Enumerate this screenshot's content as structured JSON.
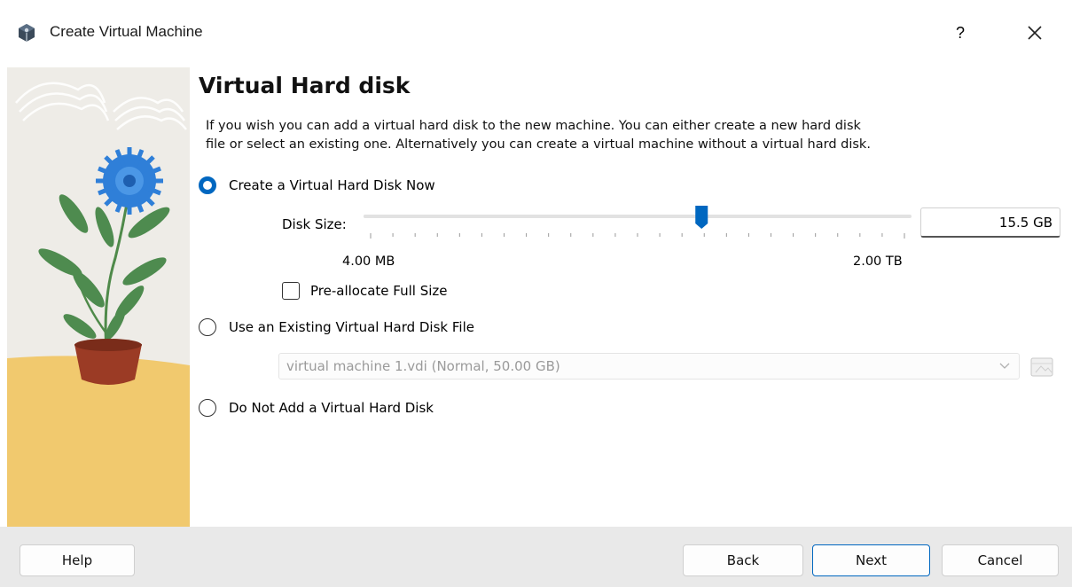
{
  "window": {
    "title": "Create Virtual Machine",
    "help_label": "?"
  },
  "page": {
    "heading": "Virtual Hard disk",
    "description_line1": "If you wish you can add a virtual hard disk to the new machine. You can either create a new hard disk",
    "description_line2": "file or select an existing one. Alternatively you can create a virtual machine without a virtual hard disk."
  },
  "options": {
    "create_now": {
      "label": "Create a Virtual Hard Disk Now",
      "checked": true
    },
    "use_existing": {
      "label": "Use an Existing Virtual Hard Disk File",
      "checked": false
    },
    "do_not_add": {
      "label": "Do Not Add a Virtual Hard Disk",
      "checked": false
    }
  },
  "disk_size": {
    "label": "Disk Size:",
    "value": "15.5 GB",
    "min_label": "4.00 MB",
    "max_label": "2.00 TB",
    "slider_fraction": 0.62
  },
  "preallocate": {
    "label": "Pre-allocate Full Size",
    "checked": false
  },
  "existing_file": {
    "selected": "virtual machine 1.vdi (Normal, 50.00 GB)",
    "enabled": false
  },
  "buttons": {
    "help": "Help",
    "back": "Back",
    "next": "Next",
    "cancel": "Cancel"
  },
  "colors": {
    "accent": "#0067c0",
    "footer_bg": "#e9e9e9",
    "illustration_sand": "#f1c96e"
  },
  "icons": {
    "app": "virtualbox-icon",
    "close": "close-icon",
    "combo": "chevron-down-icon",
    "folder": "folder-browse-icon"
  }
}
